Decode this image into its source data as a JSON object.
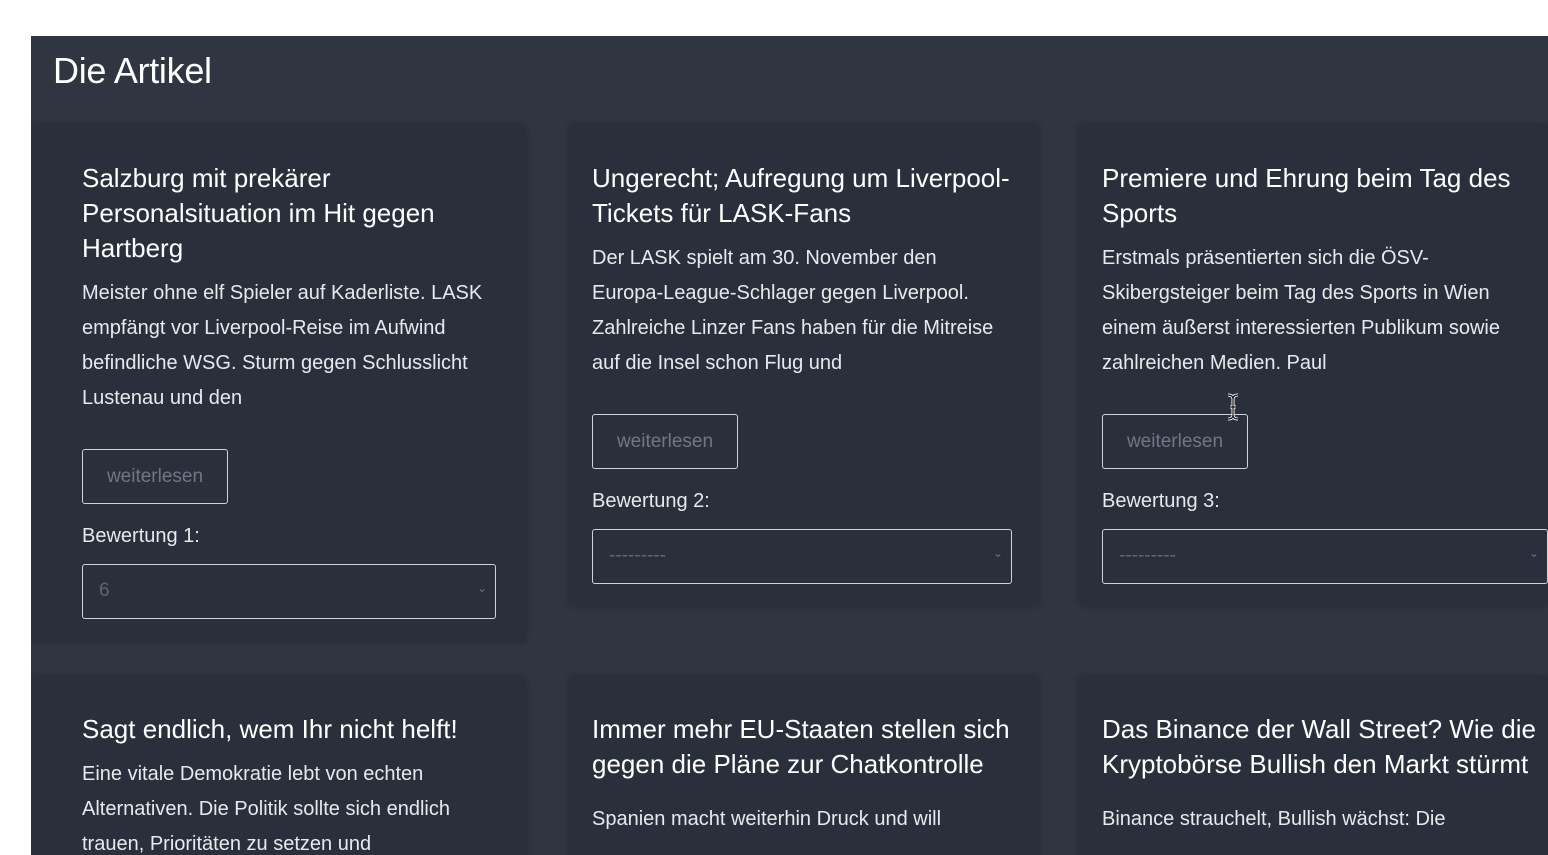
{
  "page": {
    "title": "Die Artikel"
  },
  "cards": [
    {
      "title": "Salzburg mit prekärer Personalsituation im Hit gegen Hartberg",
      "text": "Meister ohne elf Spieler auf Kaderliste. LASK empfängt vor Liverpool-Reise im Aufwind befindliche WSG. Sturm gegen Schlusslicht Lustenau und den",
      "button_label": "weiterlesen",
      "rating_label": "Bewertung 1:",
      "rating_value": "6"
    },
    {
      "title": "Ungerecht; Aufregung um Liverpool-Tickets für LASK-Fans",
      "text": "Der LASK spielt am 30. November den Europa-League-Schlager gegen Liverpool. Zahlreiche Linzer Fans haben für die Mitreise auf die Insel schon Flug und",
      "button_label": "weiterlesen",
      "rating_label": "Bewertung 2:",
      "rating_value": "---------"
    },
    {
      "title": "Premiere und Ehrung beim Tag des Sports",
      "text": "Erstmals präsentierten sich die ÖSV-Skibergsteiger beim Tag des Sports in Wien einem äußerst interessierten Publikum sowie zahlreichen Medien. Paul",
      "button_label": "weiterlesen",
      "rating_label": "Bewertung 3:",
      "rating_value": "---------"
    },
    {
      "title": "Sagt endlich, wem Ihr nicht helft!",
      "text": "Eine vitale Demokratie lebt von echten Alternativen. Die Politik sollte sich endlich trauen, Prioritäten zu setzen und"
    },
    {
      "title": "Immer mehr EU-Staaten stellen sich gegen die Pläne zur Chatkontrolle",
      "text": "Spanien macht weiterhin Druck und will"
    },
    {
      "title": "Das Binance der Wall Street? Wie die Kryptobörse Bullish den Markt stürmt",
      "text": "Binance strauchelt, Bullish wächst: Die"
    }
  ]
}
